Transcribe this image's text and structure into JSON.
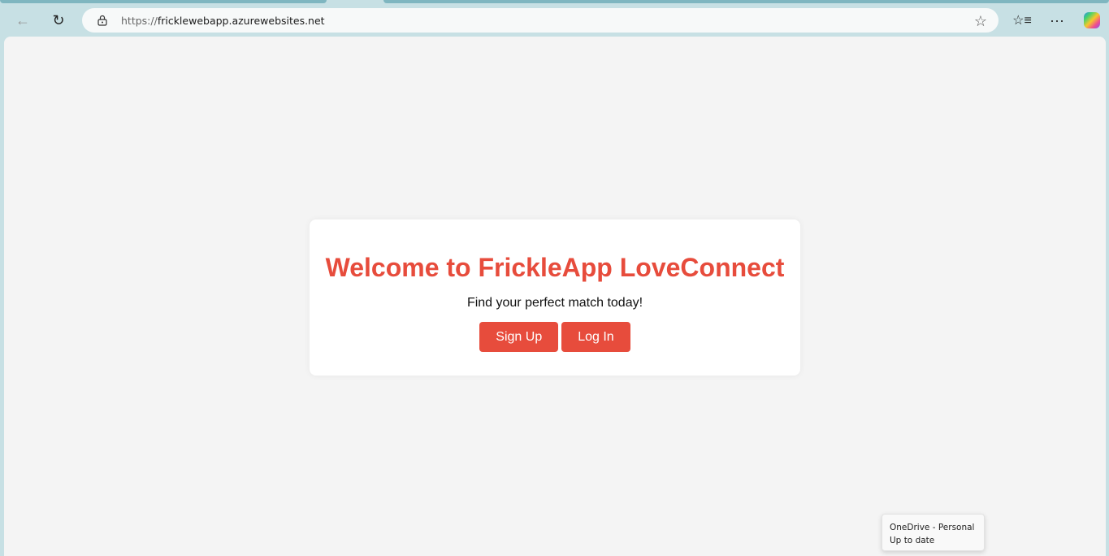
{
  "browser": {
    "url_scheme": "https://",
    "url_host": "ricklewebapp.azurewebsites.net",
    "url_host_full": "fricklewebapp.azurewebsites.net"
  },
  "page": {
    "title": "Welcome to FrickleApp LoveConnect",
    "subtitle": "Find your perfect match today!",
    "signup_label": "Sign Up",
    "login_label": "Log In",
    "accent": "#e74c3c"
  },
  "toast": {
    "line1": "OneDrive - Personal",
    "line2": "Up to date"
  }
}
